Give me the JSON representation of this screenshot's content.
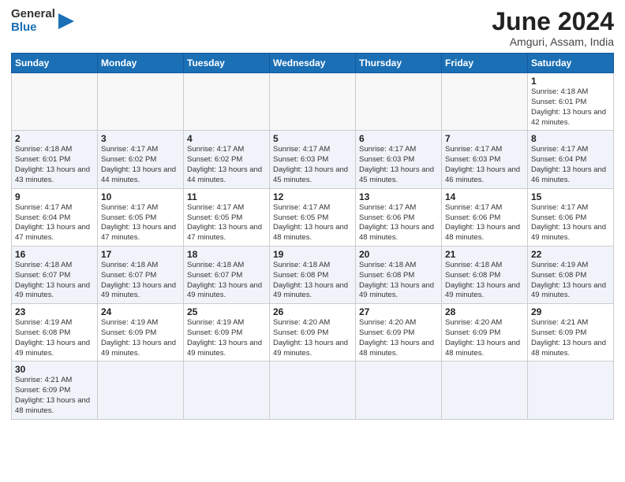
{
  "header": {
    "logo_general": "General",
    "logo_blue": "Blue",
    "title": "June 2024",
    "subtitle": "Amguri, Assam, India"
  },
  "weekdays": [
    "Sunday",
    "Monday",
    "Tuesday",
    "Wednesday",
    "Thursday",
    "Friday",
    "Saturday"
  ],
  "weeks": [
    [
      {
        "day": "",
        "info": ""
      },
      {
        "day": "",
        "info": ""
      },
      {
        "day": "",
        "info": ""
      },
      {
        "day": "",
        "info": ""
      },
      {
        "day": "",
        "info": ""
      },
      {
        "day": "",
        "info": ""
      },
      {
        "day": "1",
        "info": "Sunrise: 4:18 AM\nSunset: 6:01 PM\nDaylight: 13 hours\nand 42 minutes."
      }
    ],
    [
      {
        "day": "2",
        "info": "Sunrise: 4:18 AM\nSunset: 6:01 PM\nDaylight: 13 hours\nand 43 minutes."
      },
      {
        "day": "3",
        "info": "Sunrise: 4:17 AM\nSunset: 6:02 PM\nDaylight: 13 hours\nand 44 minutes."
      },
      {
        "day": "4",
        "info": "Sunrise: 4:17 AM\nSunset: 6:02 PM\nDaylight: 13 hours\nand 44 minutes."
      },
      {
        "day": "5",
        "info": "Sunrise: 4:17 AM\nSunset: 6:03 PM\nDaylight: 13 hours\nand 45 minutes."
      },
      {
        "day": "6",
        "info": "Sunrise: 4:17 AM\nSunset: 6:03 PM\nDaylight: 13 hours\nand 45 minutes."
      },
      {
        "day": "7",
        "info": "Sunrise: 4:17 AM\nSunset: 6:03 PM\nDaylight: 13 hours\nand 46 minutes."
      },
      {
        "day": "8",
        "info": "Sunrise: 4:17 AM\nSunset: 6:04 PM\nDaylight: 13 hours\nand 46 minutes."
      }
    ],
    [
      {
        "day": "9",
        "info": "Sunrise: 4:17 AM\nSunset: 6:04 PM\nDaylight: 13 hours\nand 47 minutes."
      },
      {
        "day": "10",
        "info": "Sunrise: 4:17 AM\nSunset: 6:05 PM\nDaylight: 13 hours\nand 47 minutes."
      },
      {
        "day": "11",
        "info": "Sunrise: 4:17 AM\nSunset: 6:05 PM\nDaylight: 13 hours\nand 47 minutes."
      },
      {
        "day": "12",
        "info": "Sunrise: 4:17 AM\nSunset: 6:05 PM\nDaylight: 13 hours\nand 48 minutes."
      },
      {
        "day": "13",
        "info": "Sunrise: 4:17 AM\nSunset: 6:06 PM\nDaylight: 13 hours\nand 48 minutes."
      },
      {
        "day": "14",
        "info": "Sunrise: 4:17 AM\nSunset: 6:06 PM\nDaylight: 13 hours\nand 48 minutes."
      },
      {
        "day": "15",
        "info": "Sunrise: 4:17 AM\nSunset: 6:06 PM\nDaylight: 13 hours\nand 49 minutes."
      }
    ],
    [
      {
        "day": "16",
        "info": "Sunrise: 4:18 AM\nSunset: 6:07 PM\nDaylight: 13 hours\nand 49 minutes."
      },
      {
        "day": "17",
        "info": "Sunrise: 4:18 AM\nSunset: 6:07 PM\nDaylight: 13 hours\nand 49 minutes."
      },
      {
        "day": "18",
        "info": "Sunrise: 4:18 AM\nSunset: 6:07 PM\nDaylight: 13 hours\nand 49 minutes."
      },
      {
        "day": "19",
        "info": "Sunrise: 4:18 AM\nSunset: 6:08 PM\nDaylight: 13 hours\nand 49 minutes."
      },
      {
        "day": "20",
        "info": "Sunrise: 4:18 AM\nSunset: 6:08 PM\nDaylight: 13 hours\nand 49 minutes."
      },
      {
        "day": "21",
        "info": "Sunrise: 4:18 AM\nSunset: 6:08 PM\nDaylight: 13 hours\nand 49 minutes."
      },
      {
        "day": "22",
        "info": "Sunrise: 4:19 AM\nSunset: 6:08 PM\nDaylight: 13 hours\nand 49 minutes."
      }
    ],
    [
      {
        "day": "23",
        "info": "Sunrise: 4:19 AM\nSunset: 6:08 PM\nDaylight: 13 hours\nand 49 minutes."
      },
      {
        "day": "24",
        "info": "Sunrise: 4:19 AM\nSunset: 6:09 PM\nDaylight: 13 hours\nand 49 minutes."
      },
      {
        "day": "25",
        "info": "Sunrise: 4:19 AM\nSunset: 6:09 PM\nDaylight: 13 hours\nand 49 minutes."
      },
      {
        "day": "26",
        "info": "Sunrise: 4:20 AM\nSunset: 6:09 PM\nDaylight: 13 hours\nand 49 minutes."
      },
      {
        "day": "27",
        "info": "Sunrise: 4:20 AM\nSunset: 6:09 PM\nDaylight: 13 hours\nand 48 minutes."
      },
      {
        "day": "28",
        "info": "Sunrise: 4:20 AM\nSunset: 6:09 PM\nDaylight: 13 hours\nand 48 minutes."
      },
      {
        "day": "29",
        "info": "Sunrise: 4:21 AM\nSunset: 6:09 PM\nDaylight: 13 hours\nand 48 minutes."
      }
    ],
    [
      {
        "day": "30",
        "info": "Sunrise: 4:21 AM\nSunset: 6:09 PM\nDaylight: 13 hours\nand 48 minutes."
      },
      {
        "day": "",
        "info": ""
      },
      {
        "day": "",
        "info": ""
      },
      {
        "day": "",
        "info": ""
      },
      {
        "day": "",
        "info": ""
      },
      {
        "day": "",
        "info": ""
      },
      {
        "day": "",
        "info": ""
      }
    ]
  ]
}
